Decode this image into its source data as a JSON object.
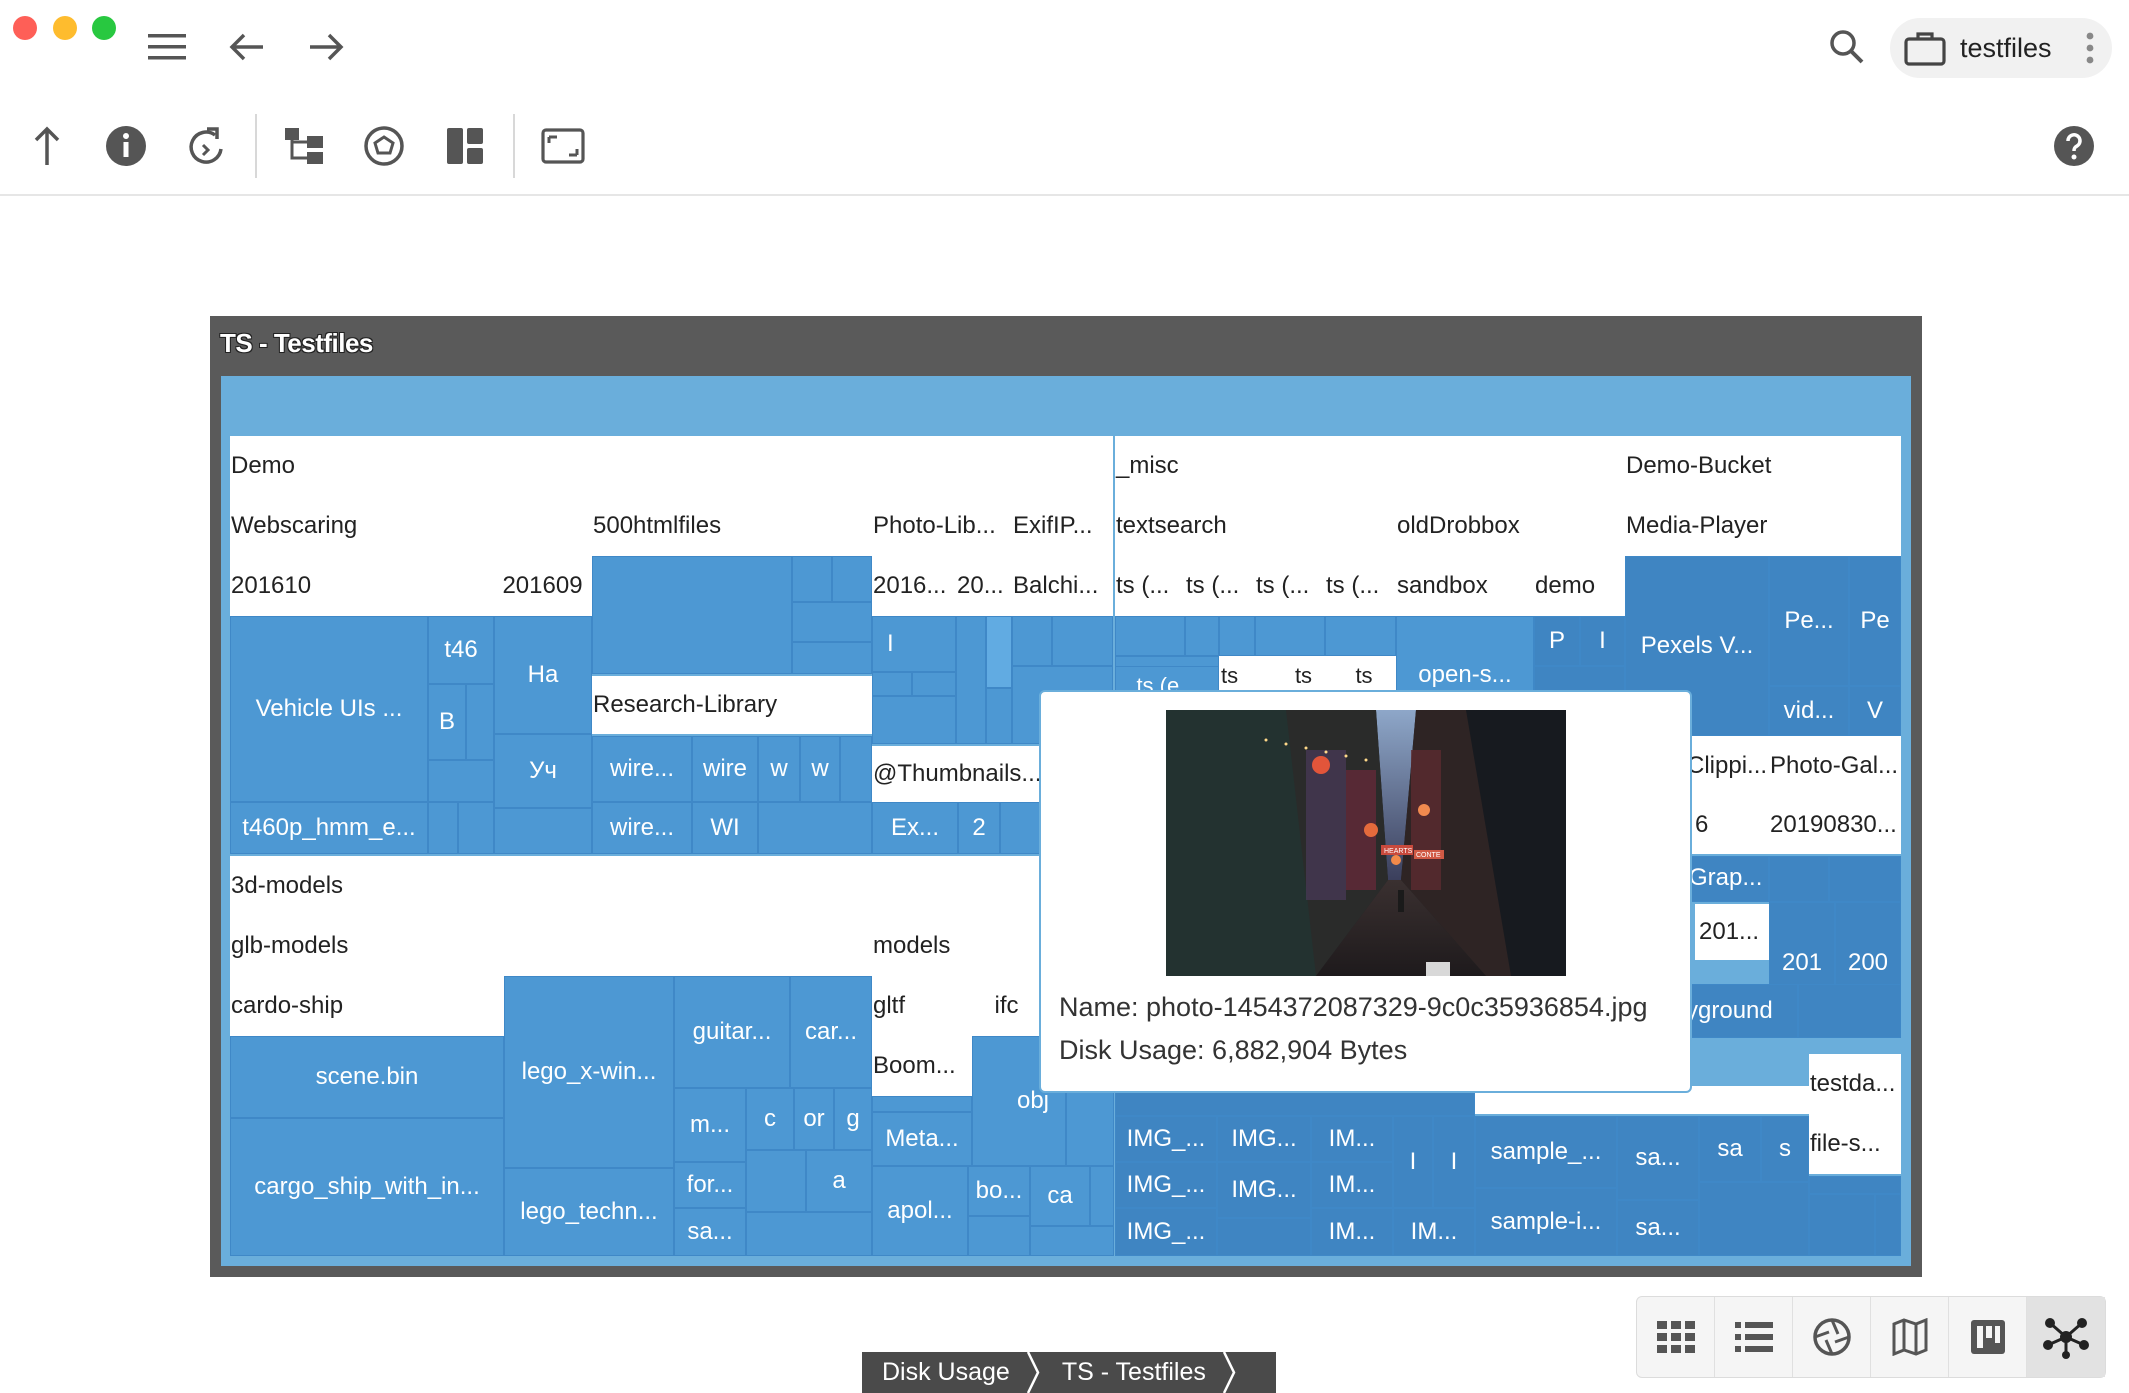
{
  "window": {
    "traffic_colors": {
      "close": "#fe5f57",
      "minimize": "#febc2e",
      "maximize": "#28c840"
    }
  },
  "location": {
    "label": "testfiles"
  },
  "toolbar": {
    "icons": [
      "menu-icon",
      "back-icon",
      "forward-icon",
      "parent-folder-icon",
      "info-icon",
      "reload-icon",
      "folder-tree-icon",
      "perspective-icon",
      "layout-icon",
      "fullscreen-icon",
      "help-icon"
    ]
  },
  "treemap": {
    "title": "TS - Testfiles",
    "colors": {
      "frame": "#5a5a5a",
      "root": "#6aaedb",
      "cell": "#4d98d3",
      "header": "#ffffff"
    },
    "headers": {
      "demo": "Demo",
      "webscaring": "Webscaring",
      "f201610": "201610",
      "f201609": "201609",
      "htmlfiles": "500htmlfiles",
      "photolib": "Photo-Lib...",
      "exifip": "ExifIP...",
      "f2016": "2016...",
      "f20": "20...",
      "balchi": "Balchi...",
      "misc": "_misc",
      "textsearch": "textsearch",
      "olddrobbox": "oldDrobbox",
      "ts1": "ts (...",
      "ts2": "ts (...",
      "ts3": "ts (...",
      "ts4": "ts (...",
      "sandbox": "sandbox",
      "demofolder": "demo",
      "demobucket": "Demo-Bucket",
      "mediaplayer": "Media-Player",
      "research": "Research-Library",
      "thumbnails": "@Thumbnails...",
      "models3d": "3d-models",
      "glbmodels": "glb-models",
      "models": "models",
      "cardoship": "cardo-ship",
      "gltf": "gltf",
      "ifc": "ifc",
      "boom": "Boom...",
      "clippi": "Clippi...",
      "photogal": "Photo-Gal...",
      "six": "6",
      "d20190830": "20190830...",
      "grap": "Grap...",
      "d201": "201...",
      "yground": "yground",
      "testda": "testda...",
      "files": "file-s...",
      "ts_a": "ts (e...",
      "ts_b": "ts",
      "ts_c": "ts",
      "ts_d": "ts",
      "opens": "open-s..."
    },
    "cells": {
      "vehicle": "Vehicle UIs ...",
      "t46": "t46",
      "b": "B",
      "ha": "Ha",
      "uch": "Уч",
      "t460p": "t460p_hmm_e...",
      "wire1": "wire...",
      "wire2": "wire",
      "w1": "w",
      "w2": "w",
      "wire3": "wire...",
      "wi": "WI",
      "i1": "I",
      "ex": "Ex...",
      "two": "2",
      "p": "P",
      "i2": "I",
      "pexels": "Pexels V...",
      "pe1": "Pe...",
      "pe2": "Pe",
      "vid": "vid...",
      "v": "V",
      "c201": "201",
      "c200": "200",
      "scenebin": "scene.bin",
      "legox": "lego_x-win...",
      "guitar": "guitar...",
      "car": "car...",
      "m": "m...",
      "c": "c",
      "or": "or",
      "g": "g",
      "a": "a",
      "for": "for...",
      "sa1": "sa...",
      "cargo": "cargo_ship_with_in...",
      "legotech": "lego_techn...",
      "meta": "Meta...",
      "apol": "apol...",
      "bo": "bo...",
      "ca": "ca",
      "obj": "obj",
      "img1": "IMG_...",
      "img2": "IMG...",
      "im1": "IM...",
      "img3": "IMG_...",
      "img4": "IMG...",
      "im2": "IM...",
      "img5": "IMG_...",
      "im3": "IM...",
      "i3": "I",
      "i4": "I",
      "im4": "IM...",
      "sample1": "sample_...",
      "sa2": "sa...",
      "sa3": "sa",
      "s": "s",
      "sample2": "sample-i...",
      "sa4": "sa..."
    }
  },
  "tooltip": {
    "name": "Name: photo-1454372087329-9c0c35936854.jpg",
    "usage": "Disk Usage: 6,882,904 Bytes",
    "photo_signs": [
      "HEARTS",
      "CONTE"
    ]
  },
  "breadcrumb": [
    "Disk Usage",
    "TS - Testfiles"
  ],
  "views": [
    "grid-view-icon",
    "list-view-icon",
    "gallery-view-icon",
    "map-view-icon",
    "kanban-view-icon",
    "graph-view-icon"
  ]
}
